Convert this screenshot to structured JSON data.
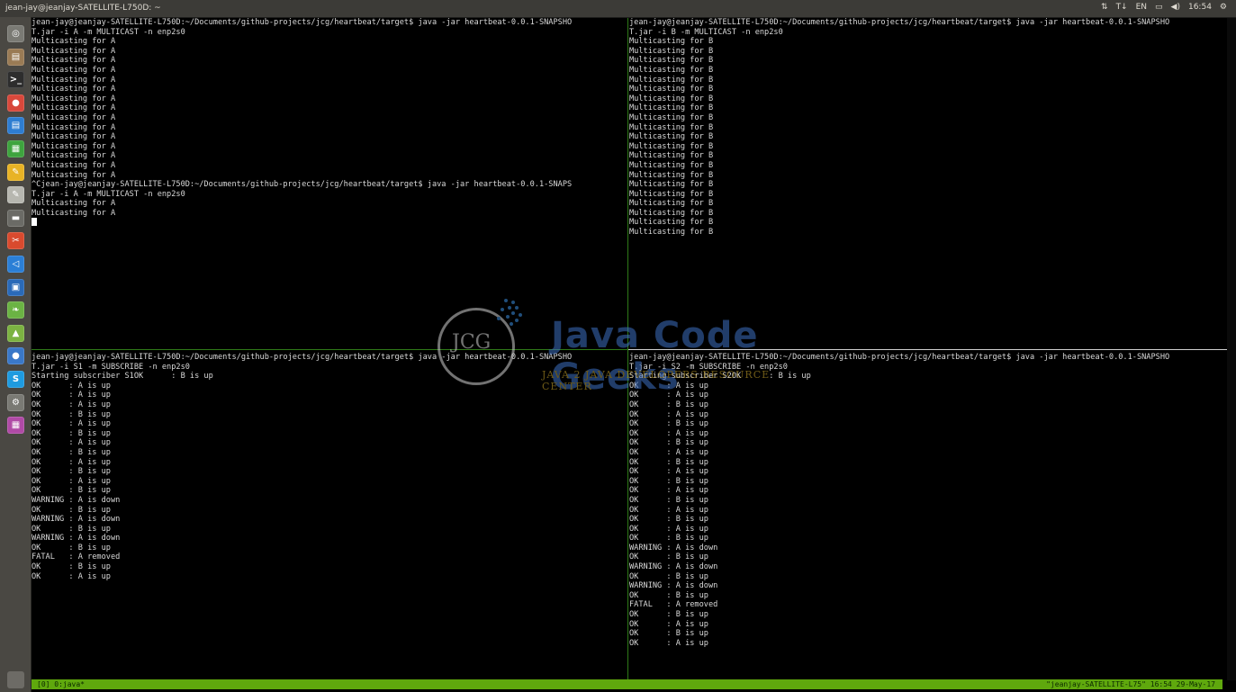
{
  "window": {
    "title": "jean-jay@jeanjay-SATELLITE-L750D: ~",
    "indicators": [
      "⇅",
      "T↓",
      "EN",
      "▭",
      "◀)",
      "16:54",
      "⚙"
    ]
  },
  "launcher": {
    "icons": [
      {
        "name": "dash-home-icon",
        "color": "#7a7a74",
        "glyph": "◎"
      },
      {
        "name": "files-icon",
        "color": "#9a7b55",
        "glyph": "▤"
      },
      {
        "name": "terminal-icon",
        "color": "#2d2d2d",
        "glyph": ">_"
      },
      {
        "name": "chrome-icon",
        "color": "#d8483b",
        "glyph": "●"
      },
      {
        "name": "writer-icon",
        "color": "#2e7dd1",
        "glyph": "▤"
      },
      {
        "name": "calc-icon",
        "color": "#3ea43e",
        "glyph": "▦"
      },
      {
        "name": "notes-icon",
        "color": "#e8b325",
        "glyph": "✎"
      },
      {
        "name": "text-editor-icon",
        "color": "#b7b7b0",
        "glyph": "✎"
      },
      {
        "name": "drive-icon",
        "color": "#6b6b66",
        "glyph": "▬"
      },
      {
        "name": "tools-icon",
        "color": "#d94a2e",
        "glyph": "✂"
      },
      {
        "name": "vscode-icon",
        "color": "#2b7fd6",
        "glyph": "◁"
      },
      {
        "name": "virtualbox-icon",
        "color": "#2a6ab8",
        "glyph": "▣"
      },
      {
        "name": "spring-icon",
        "color": "#6bb344",
        "glyph": "❧"
      },
      {
        "name": "android-icon",
        "color": "#7cb342",
        "glyph": "▲"
      },
      {
        "name": "chromium-icon",
        "color": "#3a78c8",
        "glyph": "●"
      },
      {
        "name": "skype-icon",
        "color": "#1e9be0",
        "glyph": "S"
      },
      {
        "name": "settings-icon",
        "color": "#7a7a74",
        "glyph": "⚙"
      },
      {
        "name": "workspaces-icon",
        "color": "#b04aa6",
        "glyph": "▦"
      }
    ],
    "trash_glyph": "🗑"
  },
  "panes": {
    "top_left": [
      "jean-jay@jeanjay-SATELLITE-L750D:~/Documents/github-projects/jcg/heartbeat/target$ java -jar heartbeat-0.0.1-SNAPSHO",
      "T.jar -i A -m MULTICAST -n enp2s0",
      "Multicasting for A",
      "Multicasting for A",
      "Multicasting for A",
      "Multicasting for A",
      "Multicasting for A",
      "Multicasting for A",
      "Multicasting for A",
      "Multicasting for A",
      "Multicasting for A",
      "Multicasting for A",
      "Multicasting for A",
      "Multicasting for A",
      "Multicasting for A",
      "Multicasting for A",
      "Multicasting for A",
      "^Cjean-jay@jeanjay-SATELLITE-L750D:~/Documents/github-projects/jcg/heartbeat/target$ java -jar heartbeat-0.0.1-SNAPS",
      "T.jar -i A -m MULTICAST -n enp2s0",
      "Multicasting for A",
      "Multicasting for A"
    ],
    "top_right": [
      "jean-jay@jeanjay-SATELLITE-L750D:~/Documents/github-projects/jcg/heartbeat/target$ java -jar heartbeat-0.0.1-SNAPSHO",
      "T.jar -i B -m MULTICAST -n enp2s0",
      "Multicasting for B",
      "Multicasting for B",
      "Multicasting for B",
      "Multicasting for B",
      "Multicasting for B",
      "Multicasting for B",
      "Multicasting for B",
      "Multicasting for B",
      "Multicasting for B",
      "Multicasting for B",
      "Multicasting for B",
      "Multicasting for B",
      "Multicasting for B",
      "Multicasting for B",
      "Multicasting for B",
      "Multicasting for B",
      "Multicasting for B",
      "Multicasting for B",
      "Multicasting for B",
      "Multicasting for B",
      "Multicasting for B"
    ],
    "bottom_left": [
      "jean-jay@jeanjay-SATELLITE-L750D:~/Documents/github-projects/jcg/heartbeat/target$ java -jar heartbeat-0.0.1-SNAPSHO",
      "T.jar -i S1 -m SUBSCRIBE -n enp2s0",
      "Starting subscriber S1OK      : B is up",
      "OK      : A is up",
      "OK      : A is up",
      "OK      : A is up",
      "OK      : B is up",
      "OK      : A is up",
      "OK      : B is up",
      "OK      : A is up",
      "OK      : B is up",
      "OK      : A is up",
      "OK      : B is up",
      "OK      : A is up",
      "OK      : B is up",
      "WARNING : A is down",
      "OK      : B is up",
      "WARNING : A is down",
      "OK      : B is up",
      "WARNING : A is down",
      "OK      : B is up",
      "FATAL   : A removed",
      "OK      : B is up",
      "OK      : A is up"
    ],
    "bottom_right": [
      "jean-jay@jeanjay-SATELLITE-L750D:~/Documents/github-projects/jcg/heartbeat/target$ java -jar heartbeat-0.0.1-SNAPSHO",
      "T.jar -i S2 -m SUBSCRIBE -n enp2s0",
      "Starting subscriber S2OK      : B is up",
      "OK      : A is up",
      "OK      : A is up",
      "OK      : B is up",
      "OK      : A is up",
      "OK      : B is up",
      "OK      : A is up",
      "OK      : B is up",
      "OK      : A is up",
      "OK      : B is up",
      "OK      : A is up",
      "OK      : B is up",
      "OK      : A is up",
      "OK      : B is up",
      "OK      : A is up",
      "OK      : B is up",
      "OK      : A is up",
      "OK      : B is up",
      "WARNING : A is down",
      "OK      : B is up",
      "WARNING : A is down",
      "OK      : B is up",
      "WARNING : A is down",
      "OK      : B is up",
      "FATAL   : A removed",
      "OK      : B is up",
      "OK      : A is up",
      "OK      : B is up",
      "OK      : A is up"
    ]
  },
  "statusbar": {
    "left": "[0] 0:java*",
    "right": "\"jeanjay-SATELLITE-L75\" 16:54 29-May-17"
  },
  "watermark": {
    "logo_text": "JCG",
    "title": "Java Code Geeks",
    "subtitle": "JAVA 2 JAVA DEVELOPERS RESOURCE CENTER"
  }
}
